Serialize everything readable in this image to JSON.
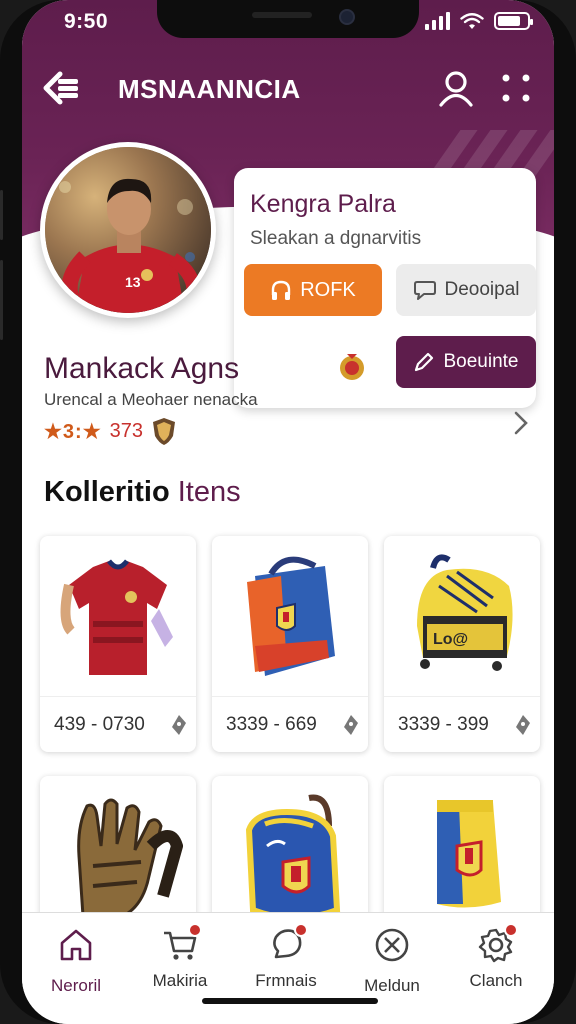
{
  "status_bar": {
    "time": "9:50"
  },
  "header": {
    "app_title": "MSNAANNCIA"
  },
  "profile": {
    "name": "Kengra Palra",
    "subtitle": "Sleakan a dgnarvitis",
    "follow_label": "ROFK",
    "message_label": "Deooipal",
    "contact_label": "Boeuinte"
  },
  "club": {
    "name": "Mankack Agns",
    "description": "Urencal a Meohaer nenacka",
    "rating_stars": "★3:★",
    "rating_value": "373"
  },
  "section": {
    "title": "Kolleritio",
    "title_accent": "Itens"
  },
  "items": [
    {
      "price": "439 - 0730",
      "kind": "jersey-image"
    },
    {
      "price": "3339 - 669",
      "kind": "bag-image"
    },
    {
      "price": "3339 - 399",
      "kind": "boot-image"
    },
    {
      "price": "",
      "kind": "gloves-image"
    },
    {
      "price": "",
      "kind": "backpack-image"
    },
    {
      "price": "",
      "kind": "sock-image"
    }
  ],
  "tabbar": {
    "tabs": [
      {
        "label": "Neroril",
        "icon": "home-icon",
        "active": true
      },
      {
        "label": "Makiria",
        "icon": "cart-icon"
      },
      {
        "label": "Frmnais",
        "icon": "chat-icon"
      },
      {
        "label": "Meldun",
        "icon": "close-circle-icon"
      },
      {
        "label": "Clanch",
        "icon": "gear-icon"
      }
    ]
  },
  "colors": {
    "brand": "#5e1d4c",
    "accent": "#ec7a24",
    "badge": "#c8312d"
  }
}
